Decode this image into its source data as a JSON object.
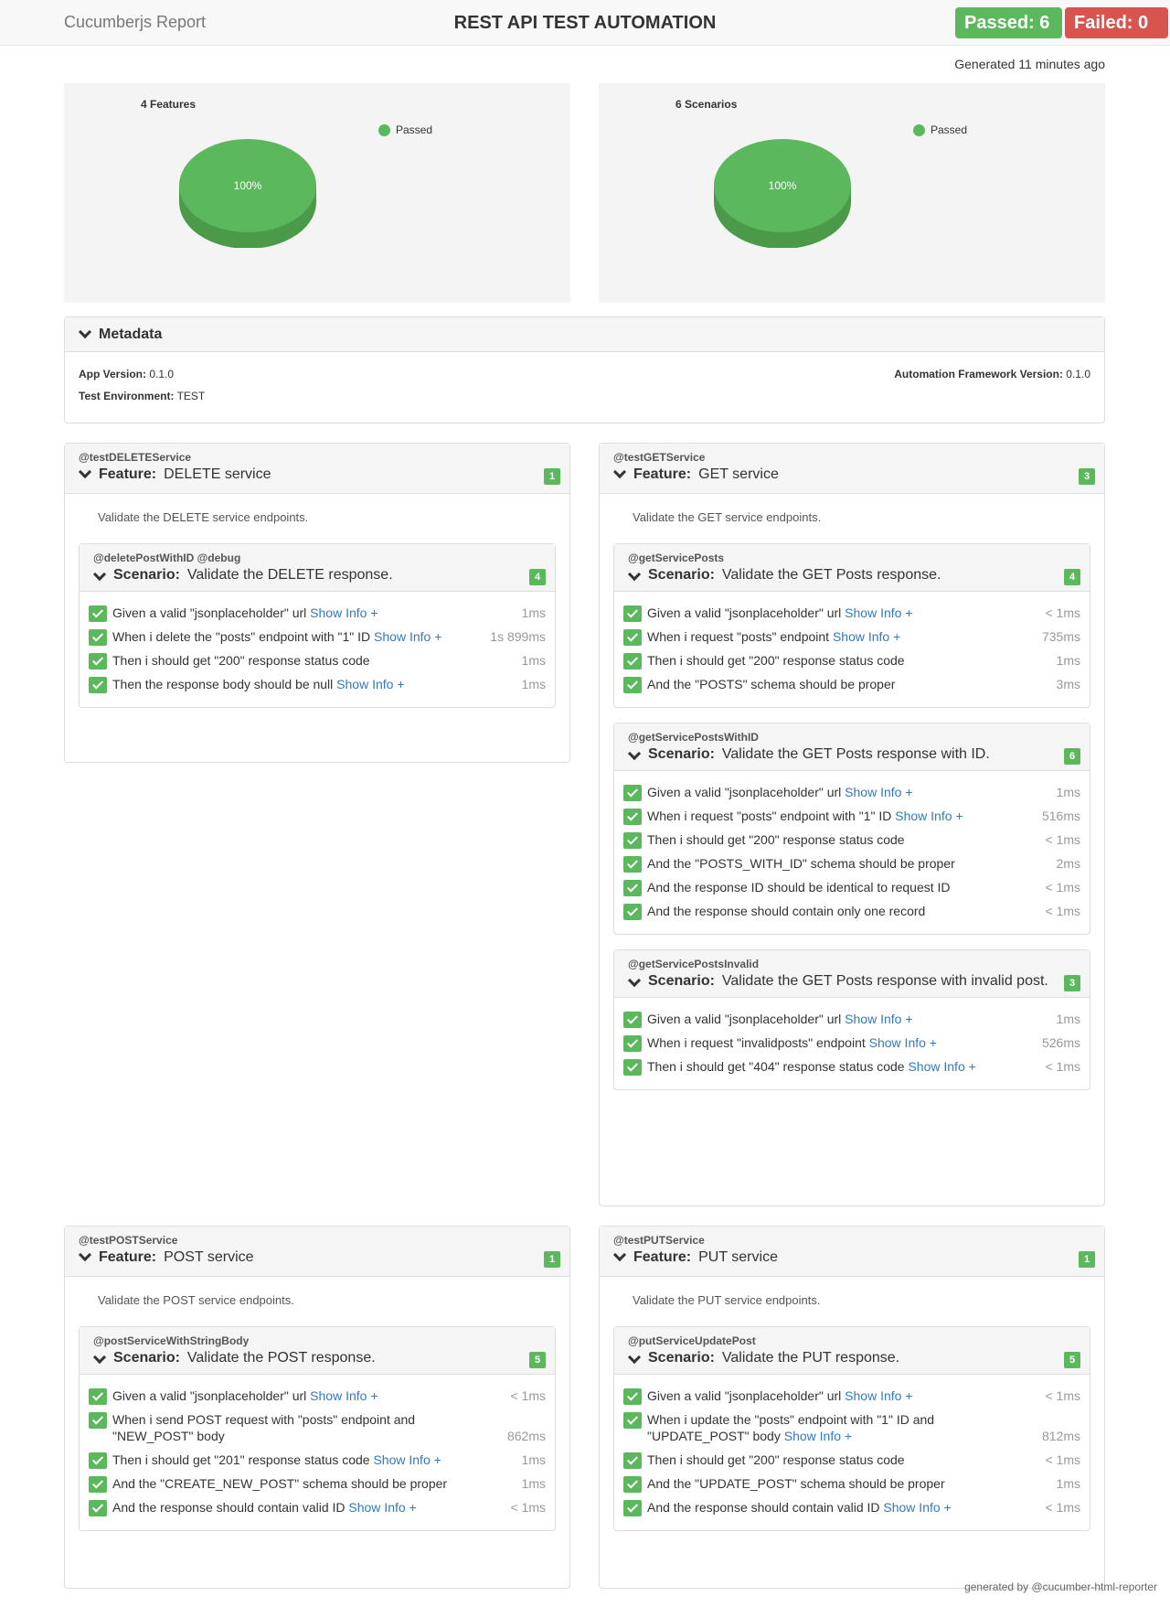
{
  "header": {
    "brand": "Cucumberjs Report",
    "title": "REST API TEST AUTOMATION",
    "passed": "Passed: 6",
    "failed": "Failed: 0"
  },
  "generated": "Generated 11 minutes ago",
  "charts": {
    "features": {
      "title": "4 Features",
      "legend": "Passed",
      "label": "100%",
      "passed_fraction": 1.0
    },
    "scenarios": {
      "title": "6 Scenarios",
      "legend": "Passed",
      "label": "100%",
      "passed_fraction": 1.0
    }
  },
  "metadata": {
    "heading": "Metadata",
    "app_version_label": "App Version:",
    "app_version": "0.1.0",
    "env_label": "Test Environment:",
    "env": "TEST",
    "framework_label": "Automation Framework Version:",
    "framework": "0.1.0"
  },
  "features": {
    "delete": {
      "tag": "@testDELETEService",
      "keyword": "Feature:",
      "name": "DELETE service",
      "count": "1",
      "description": "Validate the DELETE service endpoints.",
      "s1": {
        "tags": "@deletePostWithID @debug",
        "keyword": "Scenario:",
        "name": "Validate the DELETE response.",
        "count": "4",
        "steps": [
          {
            "text": "Given a valid \"jsonplaceholder\" url",
            "info": "Show Info +",
            "dur": "1ms"
          },
          {
            "text": "When i delete the \"posts\" endpoint with \"1\" ID",
            "info": "Show Info +",
            "dur": "1s 899ms"
          },
          {
            "text": "Then i should get \"200\" response status code",
            "info": "",
            "dur": "1ms"
          },
          {
            "text": "Then the response body should be null",
            "info": "Show Info +",
            "dur": "1ms"
          }
        ]
      }
    },
    "get": {
      "tag": "@testGETService",
      "keyword": "Feature:",
      "name": "GET service",
      "count": "3",
      "description": "Validate the GET service endpoints.",
      "s1": {
        "tags": "@getServicePosts",
        "keyword": "Scenario:",
        "name": "Validate the GET Posts response.",
        "count": "4",
        "steps": [
          {
            "text": "Given a valid \"jsonplaceholder\" url",
            "info": "Show Info +",
            "dur": "< 1ms"
          },
          {
            "text": "When i request \"posts\" endpoint",
            "info": "Show Info +",
            "dur": "735ms"
          },
          {
            "text": "Then i should get \"200\" response status code",
            "info": "",
            "dur": "1ms"
          },
          {
            "text": "And the \"POSTS\" schema should be proper",
            "info": "",
            "dur": "3ms"
          }
        ]
      },
      "s2": {
        "tags": "@getServicePostsWithID",
        "keyword": "Scenario:",
        "name": "Validate the GET Posts response with ID.",
        "count": "6",
        "steps": [
          {
            "text": "Given a valid \"jsonplaceholder\" url",
            "info": "Show Info +",
            "dur": "1ms"
          },
          {
            "text": "When i request \"posts\" endpoint with \"1\" ID",
            "info": "Show Info +",
            "dur": "516ms"
          },
          {
            "text": "Then i should get \"200\" response status code",
            "info": "",
            "dur": "< 1ms"
          },
          {
            "text": "And the \"POSTS_WITH_ID\" schema should be proper",
            "info": "",
            "dur": "2ms"
          },
          {
            "text": "And the response ID should be identical to request ID",
            "info": "",
            "dur": "< 1ms"
          },
          {
            "text": "And the response should contain only one record",
            "info": "",
            "dur": "< 1ms"
          }
        ]
      },
      "s3": {
        "tags": "@getServicePostsInvalid",
        "keyword": "Scenario:",
        "name": "Validate the GET Posts response with invalid post.",
        "count": "3",
        "steps": [
          {
            "text": "Given a valid \"jsonplaceholder\" url",
            "info": "Show Info +",
            "dur": "1ms"
          },
          {
            "text": "When i request \"invalidposts\" endpoint",
            "info": "Show Info +",
            "dur": "526ms"
          },
          {
            "text": "Then i should get \"404\" response status code",
            "info": "Show Info +",
            "dur": "< 1ms"
          }
        ]
      }
    },
    "post": {
      "tag": "@testPOSTService",
      "keyword": "Feature:",
      "name": "POST service",
      "count": "1",
      "description": "Validate the POST service endpoints.",
      "s1": {
        "tags": "@postServiceWithStringBody",
        "keyword": "Scenario:",
        "name": "Validate the POST response.",
        "count": "5",
        "steps": [
          {
            "text": "Given a valid \"jsonplaceholder\" url",
            "info": "Show Info +",
            "dur": "< 1ms"
          },
          {
            "text": "When i send POST request with \"posts\" endpoint and \"NEW_POST\" body",
            "info": "",
            "dur": "862ms"
          },
          {
            "text": "Then i should get \"201\" response status code",
            "info": "Show Info +",
            "dur": "1ms"
          },
          {
            "text": "And the \"CREATE_NEW_POST\" schema should be proper",
            "info": "",
            "dur": "1ms"
          },
          {
            "text": "And the response should contain valid ID",
            "info": "Show Info +",
            "dur": "< 1ms"
          }
        ]
      }
    },
    "put": {
      "tag": "@testPUTService",
      "keyword": "Feature:",
      "name": "PUT service",
      "count": "1",
      "description": "Validate the PUT service endpoints.",
      "s1": {
        "tags": "@putServiceUpdatePost",
        "keyword": "Scenario:",
        "name": "Validate the PUT response.",
        "count": "5",
        "steps": [
          {
            "text": "Given a valid \"jsonplaceholder\" url",
            "info": "Show Info +",
            "dur": "< 1ms"
          },
          {
            "text": "When i update the \"posts\" endpoint with \"1\" ID and \"UPDATE_POST\" body",
            "info": "Show Info +",
            "dur": "812ms"
          },
          {
            "text": "Then i should get \"200\" response status code",
            "info": "",
            "dur": "< 1ms"
          },
          {
            "text": "And the \"UPDATE_POST\" schema should be proper",
            "info": "",
            "dur": "1ms"
          },
          {
            "text": "And the response should contain valid ID",
            "info": "Show Info +",
            "dur": "< 1ms"
          }
        ]
      }
    }
  },
  "footer": "generated by @cucumber-html-reporter",
  "colors": {
    "passed": "#5cb85c",
    "failed": "#d9534f",
    "link": "#337ab7"
  }
}
